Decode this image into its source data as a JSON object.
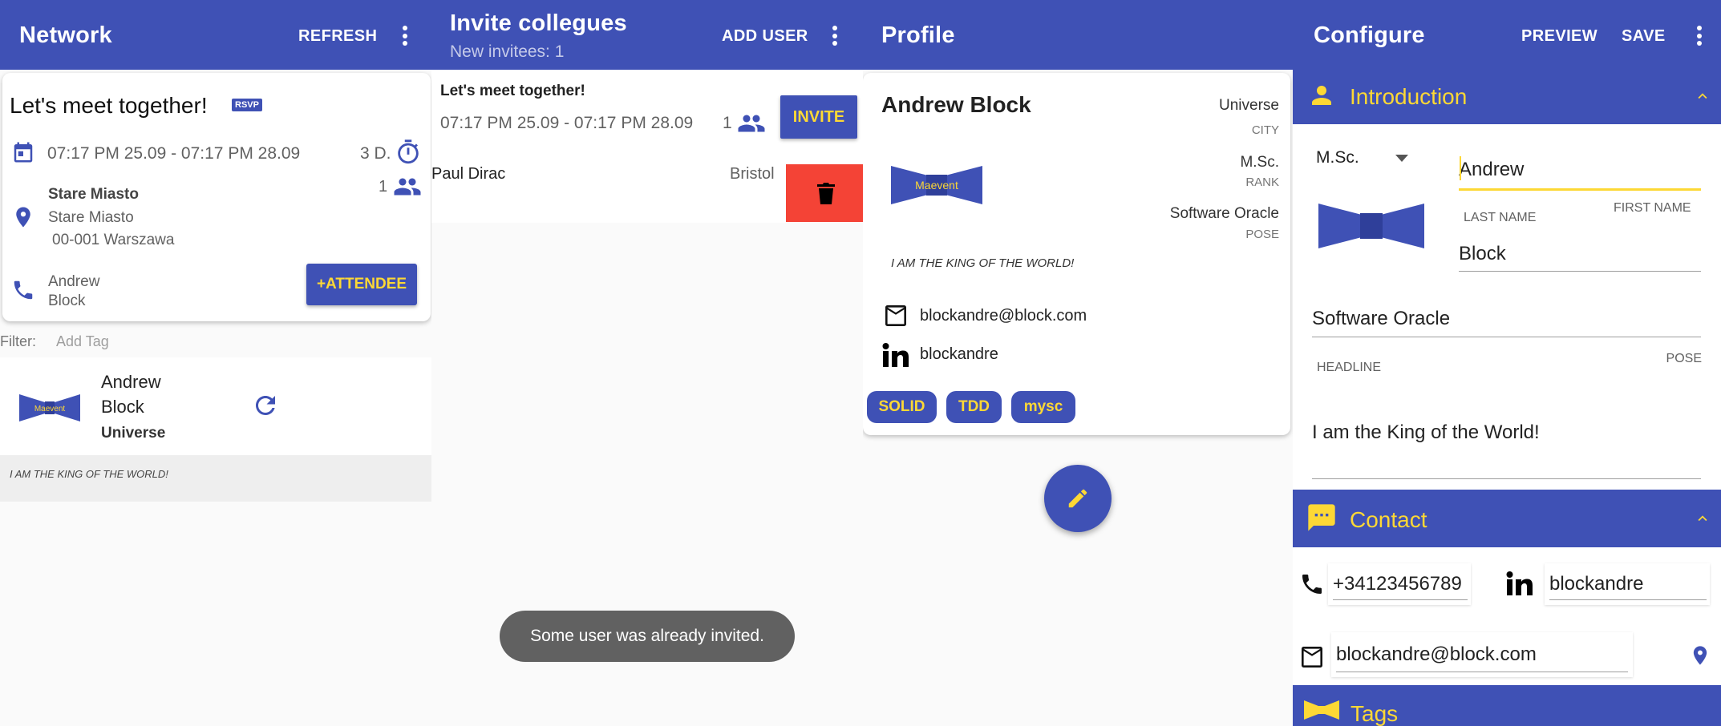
{
  "network": {
    "title": "Network",
    "refresh_label": "REFRESH",
    "event": {
      "title": "Let's meet together!",
      "rsvp_badge": "RSVP",
      "dates": "07:17 PM 25.09 - 07:17 PM 28.09",
      "duration": "3 D.",
      "attendee_count": "1",
      "location_name": "Stare Miasto",
      "location_line1": "Stare Miasto",
      "location_line2": "00-001 Warszawa",
      "contact_first": "Andrew",
      "contact_last": "Block",
      "attendee_button": "+ATTENDEE"
    },
    "filter_label": "Filter:",
    "filter_placeholder": "Add Tag",
    "person": {
      "first_name": "Andrew",
      "last_name": "Block",
      "city": "Universe",
      "quote": "I AM THE KING OF THE WORLD!",
      "logo_text": "Maevent"
    }
  },
  "invite": {
    "title": "Invite collegues",
    "subtitle": "New invitees: 1",
    "add_user_label": "ADD USER",
    "event_title": "Let's meet together!",
    "dates": "07:17 PM 25.09 - 07:17 PM 28.09",
    "count": "1",
    "invite_button": "INVITE",
    "invitee_name": "Paul Dirac",
    "invitee_city": "Bristol",
    "toast": "Some user was already invited."
  },
  "profile": {
    "title": "Profile",
    "name": "Andrew Block",
    "city_value": "Universe",
    "city_label": "CITY",
    "rank_value": "M.Sc.",
    "rank_label": "RANK",
    "pose_value": "Software Oracle",
    "pose_label": "POSE",
    "quote": "I AM THE KING OF THE WORLD!",
    "email": "blockandre@block.com",
    "linkedin": "blockandre",
    "tags": [
      "SOLID",
      "TDD",
      "mysc"
    ],
    "logo_text": "Maevent"
  },
  "configure": {
    "title": "Configure",
    "preview_label": "PREVIEW",
    "save_label": "SAVE",
    "intro_section": "Introduction",
    "rank_select": "M.Sc.",
    "first_name_value": "Andrew",
    "first_name_label": "FIRST NAME",
    "last_name_label": "LAST NAME",
    "last_name_value": "Block",
    "headline_value": "Software Oracle",
    "headline_label": "HEADLINE",
    "pose_label": "POSE",
    "motto_value": "I am the King of the World!",
    "contact_section": "Contact",
    "phone_value": "+34123456789",
    "linkedin_value": "blockandre",
    "email_value": "blockandre@block.com",
    "tags_section": "Tags"
  },
  "colors": {
    "primary": "#3f51b5",
    "accent": "#fdd835",
    "danger": "#f44336",
    "toast": "#616161"
  }
}
